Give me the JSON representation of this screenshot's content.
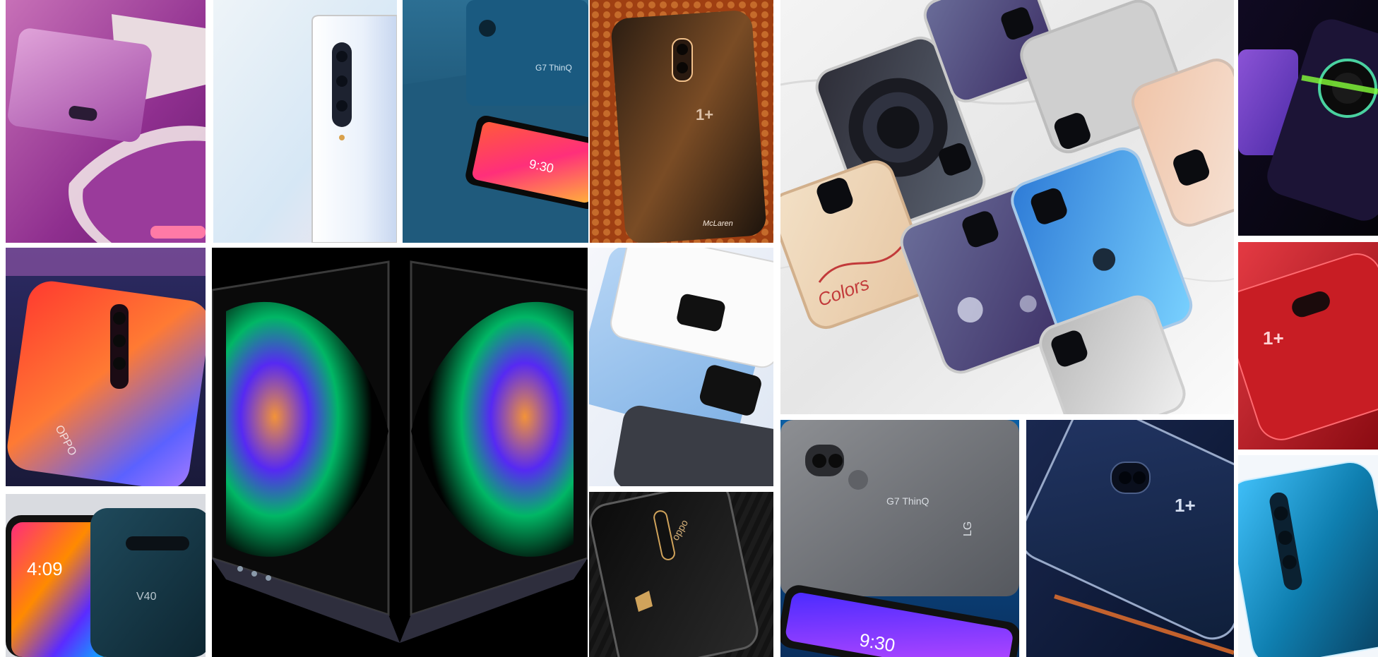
{
  "gallery": {
    "labels": {
      "lg_g7_back": "G7 ThinQ",
      "lg_g7_front_time": "9:30",
      "oneplus_mclaren_brand": "McLaren",
      "lg_v40_time": "4:09",
      "lg_v40_brand": "V40",
      "lg_g7_gray_back": "G7 ThinQ",
      "lg_g7_gray_logo": "LG",
      "lg_g7_gray_front_time": "9:30",
      "oppo_reno_lamborghini_brand": "oppo",
      "oppo_reno_red_brand": "OPPO",
      "case_text": "Colors"
    },
    "colors": {
      "galaxy_zflip_bg": "#8f2f8f",
      "lg_blue": "#1e5878",
      "mclaren_orange": "#c56b2b",
      "galaxy_fold_bg": "#000000",
      "oneplus_red": "#c81d24",
      "oneplus_navy": "#0f1f3a",
      "oppo_teal": "#0f7fb0"
    }
  }
}
